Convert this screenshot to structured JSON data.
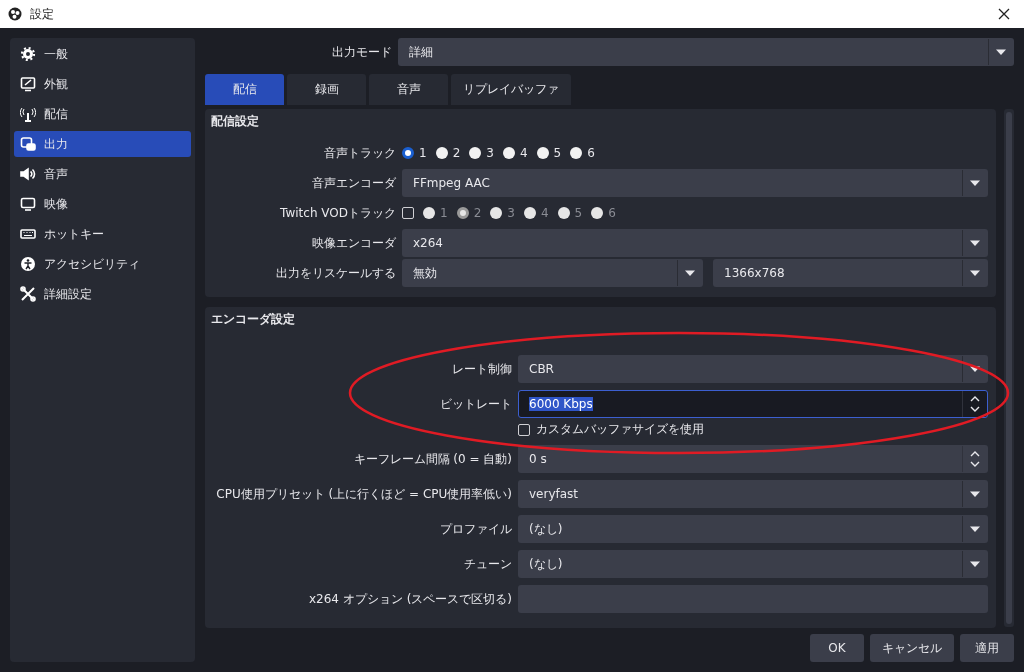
{
  "window": {
    "title": "設定"
  },
  "sidebar": {
    "items": [
      {
        "label": "一般",
        "selected": false
      },
      {
        "label": "外観",
        "selected": false
      },
      {
        "label": "配信",
        "selected": false
      },
      {
        "label": "出力",
        "selected": true
      },
      {
        "label": "音声",
        "selected": false
      },
      {
        "label": "映像",
        "selected": false
      },
      {
        "label": "ホットキー",
        "selected": false
      },
      {
        "label": "アクセシビリティ",
        "selected": false
      },
      {
        "label": "詳細設定",
        "selected": false
      }
    ]
  },
  "output_mode": {
    "label": "出力モード",
    "value": "詳細"
  },
  "tabs": [
    {
      "label": "配信",
      "selected": true
    },
    {
      "label": "録画",
      "selected": false
    },
    {
      "label": "音声",
      "selected": false
    },
    {
      "label": "リプレイバッファ",
      "selected": false
    }
  ],
  "stream_settings": {
    "title": "配信設定",
    "rows": [
      {
        "kind": "radios",
        "label": "音声トラック",
        "options": [
          {
            "label": "1",
            "selected": true
          },
          {
            "label": "2",
            "selected": false
          },
          {
            "label": "3",
            "selected": false
          },
          {
            "label": "4",
            "selected": false
          },
          {
            "label": "5",
            "selected": false
          },
          {
            "label": "6",
            "selected": false
          }
        ]
      },
      {
        "kind": "select",
        "label": "音声エンコーダ",
        "value": "FFmpeg AAC"
      },
      {
        "kind": "check_radios",
        "label": "Twitch VODトラック",
        "checked": false,
        "options": [
          {
            "label": "1",
            "selected": false
          },
          {
            "label": "2",
            "selected": true
          },
          {
            "label": "3",
            "selected": false
          },
          {
            "label": "4",
            "selected": false
          },
          {
            "label": "5",
            "selected": false
          },
          {
            "label": "6",
            "selected": false
          }
        ]
      },
      {
        "kind": "select",
        "label": "映像エンコーダ",
        "value": "x264"
      },
      {
        "kind": "double_select",
        "label": "出力をリスケールする",
        "value": "無効",
        "value_2": "1366x768"
      }
    ]
  },
  "encoder_settings": {
    "title": "エンコーダ設定",
    "rows": [
      {
        "kind": "select",
        "label": "レート制御",
        "value": "CBR"
      },
      {
        "kind": "spin",
        "label": "ビットレート",
        "value": "6000 Kbps",
        "focused": true
      },
      {
        "kind": "checkbox",
        "label": "カスタムバッファサイズを使用",
        "checked": false
      },
      {
        "kind": "spin",
        "label": "キーフレーム間隔 (0 = 自動)",
        "value": "0 s",
        "focused": false
      },
      {
        "kind": "select",
        "label": "CPU使用プリセット (上に行くほど = CPU使用率低い)",
        "value": "veryfast"
      },
      {
        "kind": "select",
        "label": "プロファイル",
        "value": "(なし)"
      },
      {
        "kind": "select",
        "label": "チューン",
        "value": "(なし)"
      },
      {
        "kind": "text",
        "label": "x264 オプション (スペースで区切る)",
        "value": ""
      }
    ]
  },
  "buttons": [
    {
      "label": "OK"
    },
    {
      "label": "キャンセル"
    },
    {
      "label": "適用"
    }
  ]
}
